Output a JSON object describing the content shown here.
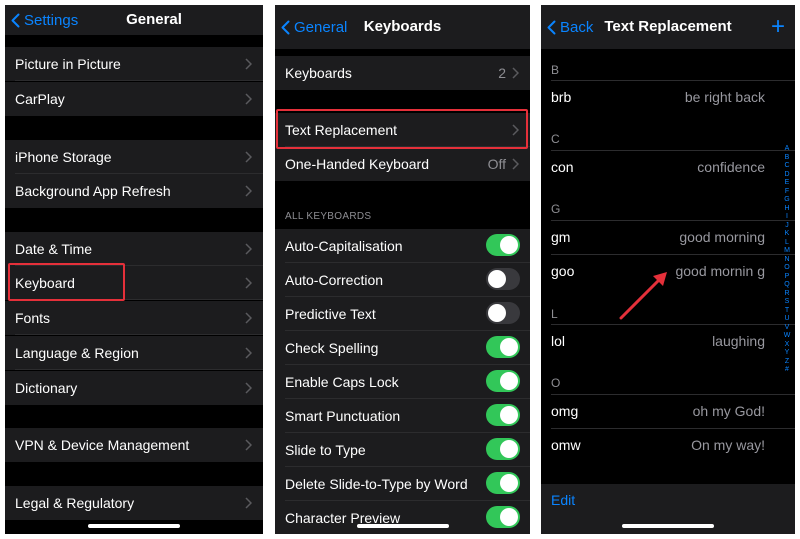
{
  "general": {
    "back": "Settings",
    "title": "General",
    "rows": [
      {
        "label": "Picture in Picture"
      },
      {
        "label": "CarPlay"
      },
      {
        "label": "iPhone Storage"
      },
      {
        "label": "Background App Refresh"
      },
      {
        "label": "Date & Time"
      },
      {
        "label": "Keyboard"
      },
      {
        "label": "Fonts"
      },
      {
        "label": "Language & Region"
      },
      {
        "label": "Dictionary"
      },
      {
        "label": "VPN & Device Management"
      },
      {
        "label": "Legal & Regulatory"
      }
    ]
  },
  "keyboards": {
    "back": "General",
    "title": "Keyboards",
    "keyboards_row": {
      "label": "Keyboards",
      "value": "2"
    },
    "text_replacement": "Text Replacement",
    "one_handed": {
      "label": "One-Handed Keyboard",
      "value": "Off"
    },
    "section": "ALL KEYBOARDS",
    "toggles": [
      {
        "label": "Auto-Capitalisation",
        "on": true
      },
      {
        "label": "Auto-Correction",
        "on": false
      },
      {
        "label": "Predictive Text",
        "on": false
      },
      {
        "label": "Check Spelling",
        "on": true
      },
      {
        "label": "Enable Caps Lock",
        "on": true
      },
      {
        "label": "Smart Punctuation",
        "on": true
      },
      {
        "label": "Slide to Type",
        "on": true
      },
      {
        "label": "Delete Slide-to-Type by Word",
        "on": true
      },
      {
        "label": "Character Preview",
        "on": true
      }
    ]
  },
  "text_replacement": {
    "back": "Back",
    "title": "Text Replacement",
    "add": "+",
    "sections": [
      "B",
      "C",
      "G",
      "L",
      "O"
    ],
    "entries": [
      {
        "shortcut": "brb",
        "phrase": "be right back"
      },
      {
        "shortcut": "con",
        "phrase": "confidence"
      },
      {
        "shortcut": "gm",
        "phrase": "good morning"
      },
      {
        "shortcut": "goo",
        "phrase": "good mornin g"
      },
      {
        "shortcut": "lol",
        "phrase": "laughing"
      },
      {
        "shortcut": "omg",
        "phrase": "oh my God!"
      },
      {
        "shortcut": "omw",
        "phrase": "On my way!"
      }
    ],
    "edit": "Edit",
    "index": [
      "A",
      "B",
      "C",
      "D",
      "E",
      "F",
      "G",
      "H",
      "I",
      "J",
      "K",
      "L",
      "M",
      "N",
      "O",
      "P",
      "Q",
      "R",
      "S",
      "T",
      "U",
      "V",
      "W",
      "X",
      "Y",
      "Z",
      "#"
    ]
  },
  "colors": {
    "accent": "#0a84ff",
    "toggle_on": "#32c759",
    "highlight": "#e5303a",
    "arrow": "#e5303a"
  }
}
